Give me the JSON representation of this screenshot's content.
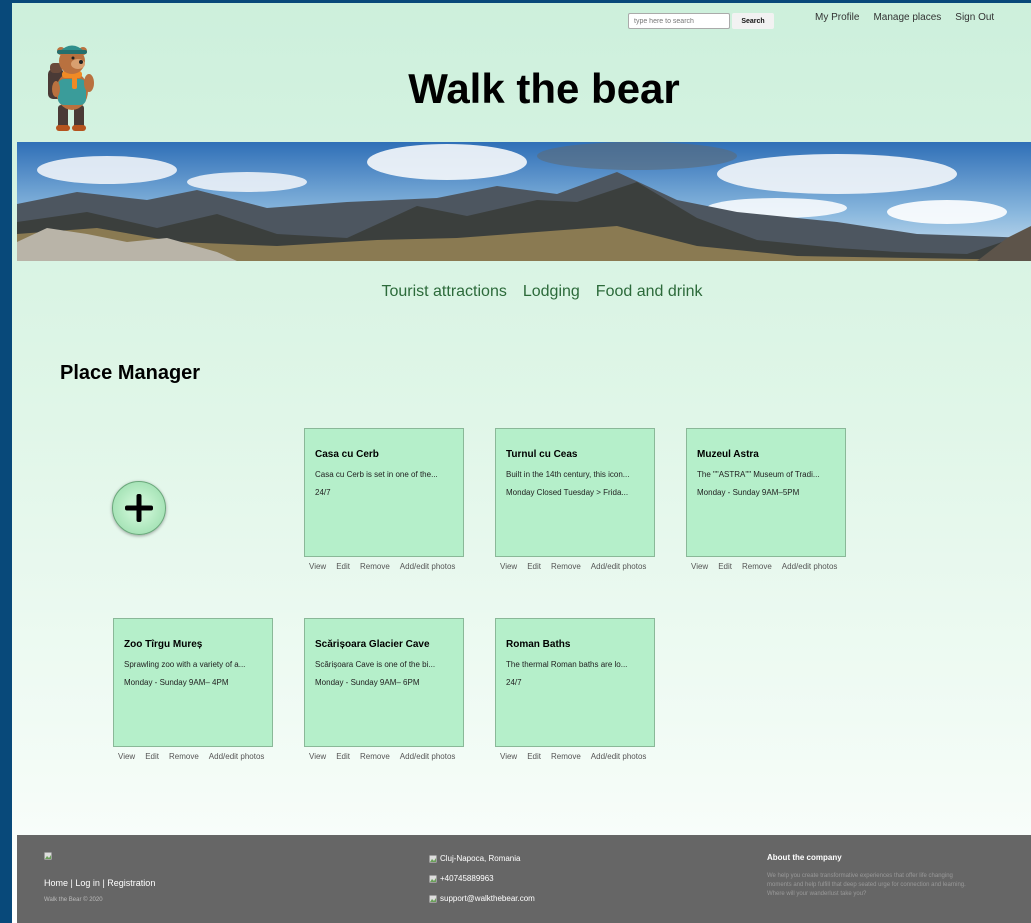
{
  "search": {
    "placeholder": "type here to search",
    "button_label": "Search"
  },
  "topnav": {
    "items": [
      "My Profile",
      "Manage places",
      "Sign Out"
    ]
  },
  "header": {
    "title": "Walk the bear"
  },
  "mainnav": {
    "items": [
      "Tourist attractions",
      "Lodging",
      "Food and drink"
    ]
  },
  "page": {
    "title": "Place Manager"
  },
  "card_actions": {
    "view": "View",
    "edit": "Edit",
    "remove": "Remove",
    "photos": "Add/edit photos"
  },
  "places": [
    {
      "title": "Casa cu Cerb",
      "desc": "Casa cu Cerb is set in one of the...",
      "hours": "24/7"
    },
    {
      "title": "Turnul cu Ceas",
      "desc": "Built in the 14th century, this icon...",
      "hours": "Monday Closed Tuesday > Frida..."
    },
    {
      "title": "Muzeul Astra",
      "desc": "The \"\"ASTRA\"\" Museum of Tradi...",
      "hours": "Monday - Sunday 9AM–5PM"
    },
    {
      "title": "Zoo Tîrgu Mureș",
      "desc": "Sprawling zoo with a variety of a...",
      "hours": "Monday - Sunday 9AM– 4PM"
    },
    {
      "title": "Scărișoara Glacier Cave",
      "desc": "Scărișoara Cave is one of the bi...",
      "hours": "Monday - Sunday 9AM– 6PM"
    },
    {
      "title": "Roman Baths",
      "desc": "The thermal Roman baths are lo...",
      "hours": "24/7"
    }
  ],
  "footer": {
    "links": [
      "Home",
      "Log in",
      "Registration"
    ],
    "separator": "|",
    "copyright": "Walk the Bear © 2020",
    "location": "Cluj-Napoca, Romania",
    "phone": "+40745889963",
    "email": "support@walkthebear.com",
    "about_title": "About the company",
    "about_text": "We help you create transformative experiences that offer life changing moments and help fulfill that deep seated urge for connection and learning. Where will your wanderlust take you?"
  },
  "colors": {
    "page_bg": "#cdf0dc",
    "card_bg": "#b5efca",
    "nav_link": "#2c6a3a",
    "footer_bg": "#666666",
    "frame": "#08497a"
  },
  "icons": {
    "logo": "bear-hiker-icon",
    "add": "plus-icon",
    "image_placeholder": "broken-image-icon"
  }
}
